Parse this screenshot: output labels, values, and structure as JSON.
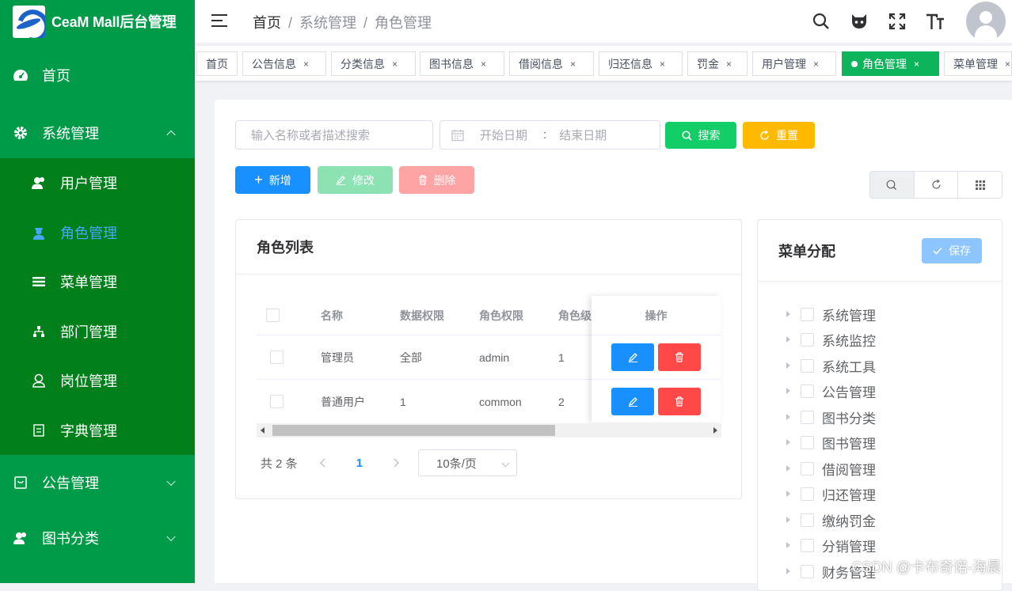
{
  "app": {
    "title": "CeaM Mall后台管理"
  },
  "sidebar": {
    "items": [
      {
        "label": "首页",
        "icon": "dashboard-icon"
      },
      {
        "label": "系统管理",
        "icon": "gear-icon",
        "expanded": true
      },
      {
        "label": "公告管理",
        "icon": "notice-icon"
      },
      {
        "label": "图书分类",
        "icon": "users-icon"
      }
    ],
    "sub": [
      {
        "label": "用户管理",
        "icon": "user-icon"
      },
      {
        "label": "角色管理",
        "icon": "role-icon",
        "active": true
      },
      {
        "label": "菜单管理",
        "icon": "list-icon"
      },
      {
        "label": "部门管理",
        "icon": "tree-icon"
      },
      {
        "label": "岗位管理",
        "icon": "post-icon"
      },
      {
        "label": "字典管理",
        "icon": "dict-icon"
      }
    ]
  },
  "header": {
    "breadcrumb": [
      "首页",
      "系统管理",
      "角色管理"
    ],
    "icons": [
      "search-icon",
      "github-icon",
      "fullscreen-icon",
      "font-size-icon"
    ]
  },
  "tags": [
    {
      "label": "首页",
      "closable": false
    },
    {
      "label": "公告信息",
      "closable": true
    },
    {
      "label": "分类信息",
      "closable": true
    },
    {
      "label": "图书信息",
      "closable": true
    },
    {
      "label": "借阅信息",
      "closable": true
    },
    {
      "label": "归还信息",
      "closable": true
    },
    {
      "label": "罚金",
      "closable": true
    },
    {
      "label": "用户管理",
      "closable": true
    },
    {
      "label": "角色管理",
      "closable": true,
      "active": true
    },
    {
      "label": "菜单管理",
      "closable": true
    }
  ],
  "close_glyph": "×",
  "search": {
    "placeholder": "输入名称或者描述搜索",
    "start_placeholder": "开始日期",
    "date_sep": ":",
    "end_placeholder": "结束日期",
    "search_label": "搜索",
    "reset_label": "重置"
  },
  "actions": {
    "add": "新增",
    "edit": "修改",
    "delete": "删除"
  },
  "colors": {
    "sidebar": "#009b48",
    "submenu": "#007f1a",
    "active_tag": "#0eb45c",
    "primary": "#1890ff",
    "success": "#13ce66",
    "warning": "#ffba00",
    "danger": "#ff4949"
  },
  "role_list": {
    "title": "角色列表",
    "columns": [
      "名称",
      "数据权限",
      "角色权限",
      "角色级",
      "操作"
    ],
    "rows": [
      {
        "name": "管理员",
        "data_scope": "全部",
        "permission": "admin",
        "level": "1"
      },
      {
        "name": "普通用户",
        "data_scope": "1",
        "permission": "common",
        "level": "2"
      }
    ],
    "pagination": {
      "total_text": "共 2 条",
      "current_page": "1",
      "page_size": "10条/页"
    }
  },
  "menu_assign": {
    "title": "菜单分配",
    "save_label": "保存",
    "items": [
      "系统管理",
      "系统监控",
      "系统工具",
      "公告管理",
      "图书分类",
      "图书管理",
      "借阅管理",
      "归还管理",
      "缴纳罚金",
      "分销管理",
      "财务管理"
    ]
  },
  "watermark": "CSDN @卡布奇诺-海晨"
}
